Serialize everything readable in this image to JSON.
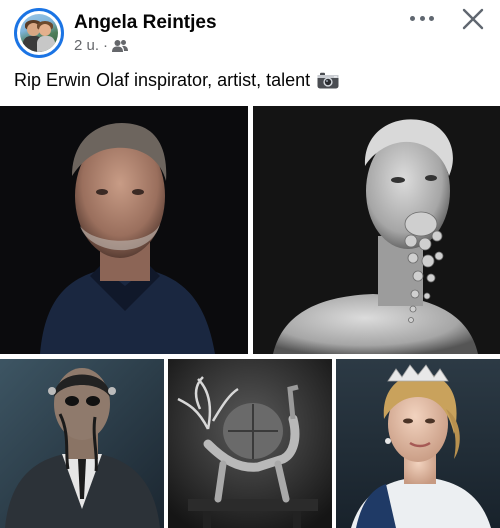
{
  "post": {
    "author_name": "Angela Reintjes",
    "timestamp": "2 u.",
    "separator": "·",
    "audience_icon": "friends-icon",
    "caption": "Rip Erwin Olaf inspirator, artist, talent",
    "caption_emoji_icon": "camera-icon"
  },
  "actions": {
    "more_icon": "more-options-icon",
    "close_icon": "close-icon"
  },
  "photos": [
    {
      "icon": "portrait-photo",
      "subject": "man in dark polo shirt"
    },
    {
      "icon": "portrait-photo",
      "subject": "woman with jewels from mouth"
    },
    {
      "icon": "portrait-photo",
      "subject": "suited figure with dark paint"
    },
    {
      "icon": "portrait-photo",
      "subject": "figure with antlers and basket"
    },
    {
      "icon": "portrait-photo",
      "subject": "woman wearing tiara"
    }
  ],
  "colors": {
    "accent": "#1b74e4",
    "text_primary": "#050505",
    "text_secondary": "#65676b"
  }
}
